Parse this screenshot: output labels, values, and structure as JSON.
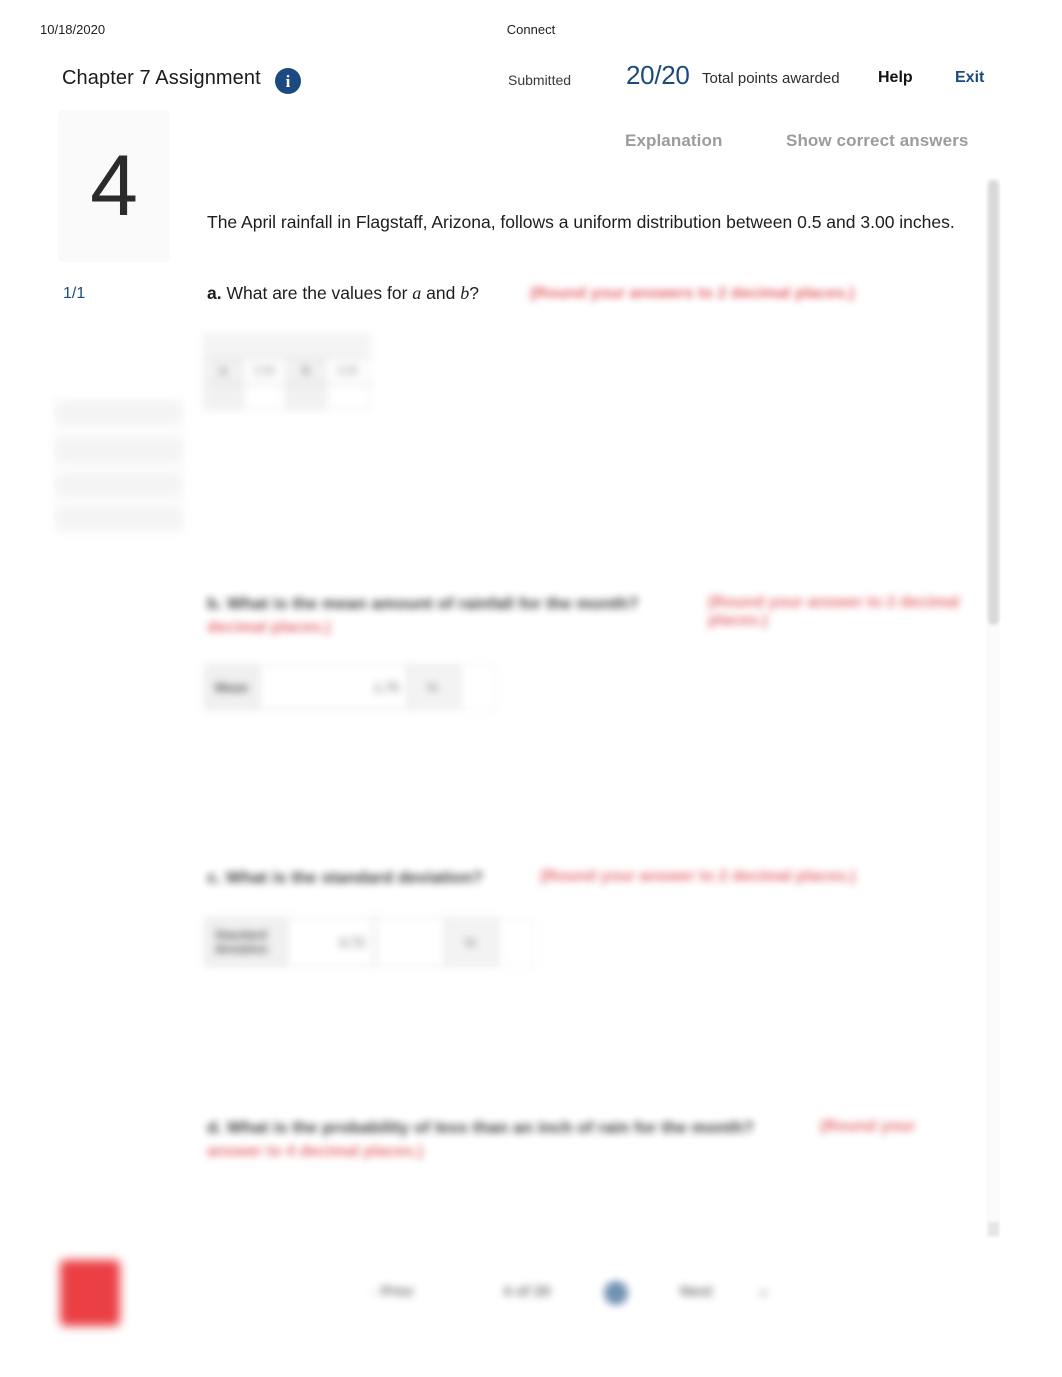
{
  "print_header": {
    "date": "10/18/2020",
    "site": "Connect"
  },
  "appbar": {
    "assignment_title": "Chapter 7 Assignment",
    "info_icon": "info-icon",
    "status": "Submitted",
    "score": "20/20",
    "points_label": "Total points awarded",
    "help": "Help",
    "exit": "Exit",
    "accent_navy": "#1c4a7e"
  },
  "tabs": {
    "explanation": "Explanation",
    "show_correct_answers": "Show correct answers"
  },
  "question": {
    "number": "4",
    "score": "1/1",
    "stem": "The April rainfall in Flagstaff, Arizona, follows a uniform distribution between 0.5 and 3.00 inches.",
    "parts": [
      {
        "letter": "a.",
        "text": "What are the values for a and b?",
        "hint": "(Round your answers to 2 decimal places.)",
        "answer_table": {
          "header": "",
          "rows": [
            {
              "label": "a",
              "value": "0.50",
              "unit": ""
            },
            {
              "label": "b",
              "value": "3.00",
              "unit": ""
            }
          ]
        }
      },
      {
        "letter": "b.",
        "text": "What is the mean amount of rainfall for the month?",
        "hint": "(Round your answer to 2 decimal places.)",
        "answer_label": "Mean",
        "answer_value": "1.75",
        "answer_unit": "in."
      },
      {
        "letter": "c.",
        "text": "What is the standard deviation?",
        "hint": "(Round your answer to 2 decimal places.)",
        "answer_label": "Standard deviation",
        "answer_value": "0.72",
        "answer_unit": "in."
      },
      {
        "letter": "d.",
        "text": "What is the probability of less than an inch of rain for the month?",
        "hint": "(Round your answer to 4 decimal places.)"
      }
    ]
  },
  "footer": {
    "logo": "mcgraw-hill-logo",
    "prev_label": "Prev",
    "pager_label": "4 of 20",
    "next_label": "Next",
    "caret": "▾",
    "prev_arrow": "‹",
    "next_arrow": "›"
  },
  "colors": {
    "hint_red": "#e0494f",
    "tab_gray": "#9c9c9c",
    "brand_red": "#e8252b"
  }
}
